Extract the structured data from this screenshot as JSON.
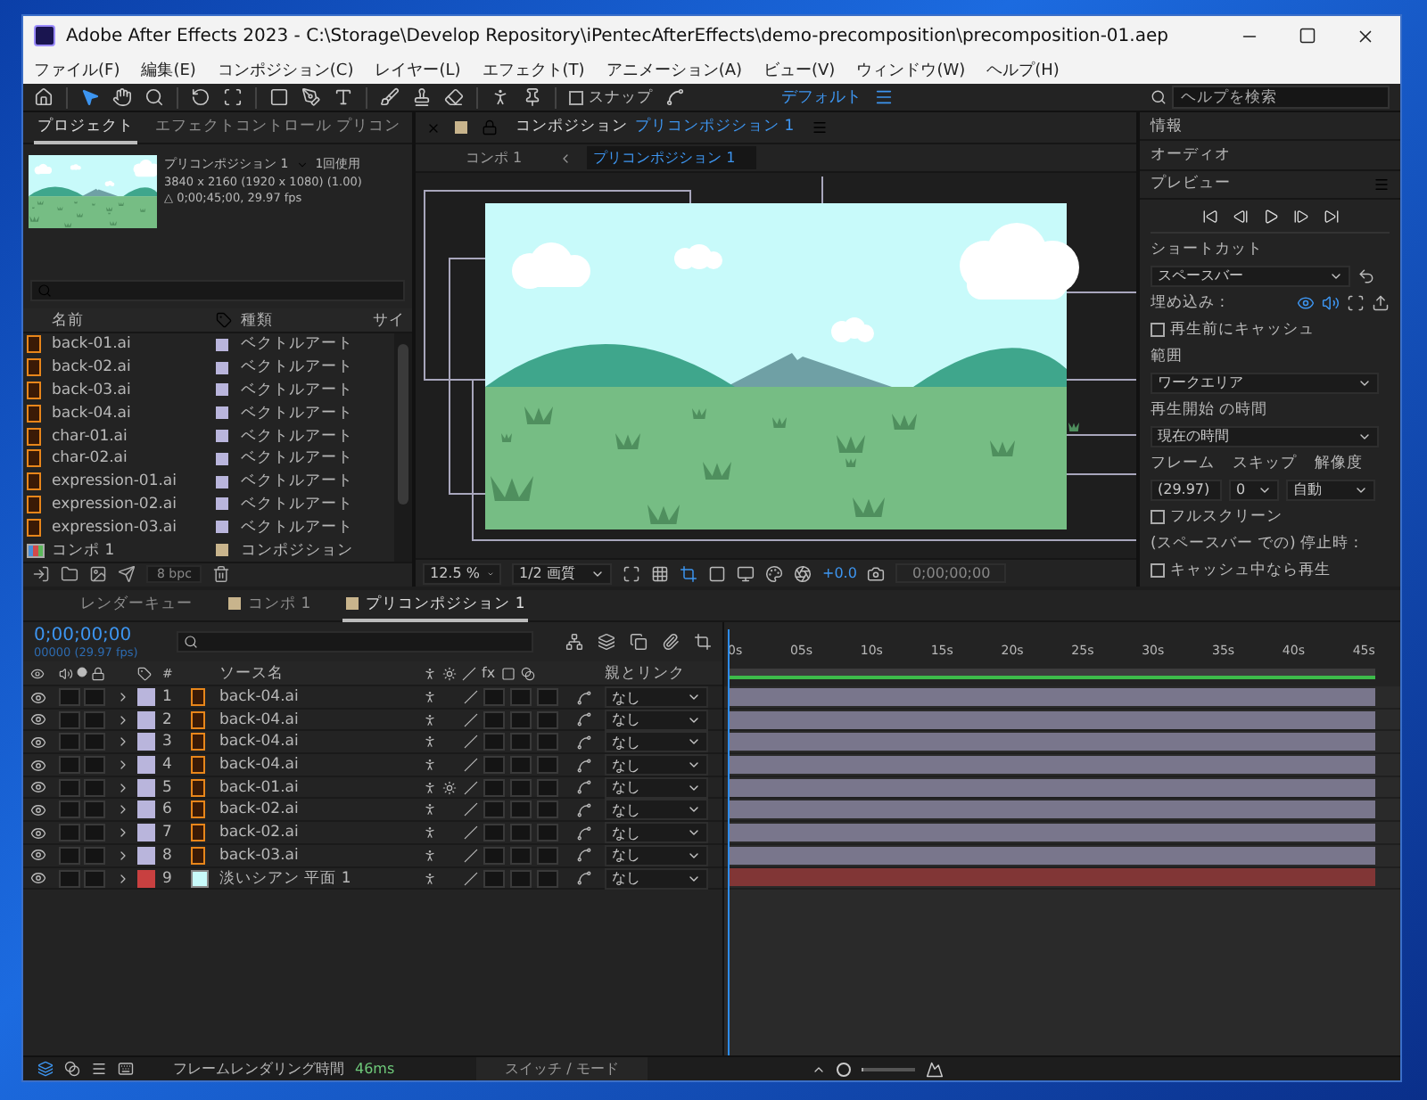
{
  "window": {
    "title": "Adobe After Effects 2023 - C:\\Storage\\Develop Repository\\iPentecAfterEffects\\demo-precomposition\\precomposition-01.aep"
  },
  "menu": [
    "ファイル(F)",
    "編集(E)",
    "コンポジション(C)",
    "レイヤー(L)",
    "エフェクト(T)",
    "アニメーション(A)",
    "ビュー(V)",
    "ウィンドウ(W)",
    "ヘルプ(H)"
  ],
  "toolbar": {
    "snap": {
      "label": "スナップ",
      "checked": false
    },
    "workspace": "デフォルト",
    "help_search": {
      "placeholder": "ヘルプを検索"
    }
  },
  "project": {
    "tabs": [
      {
        "label": "プロジェクト",
        "selected": true
      },
      {
        "label": "エフェクトコントロール プリコン",
        "selected": false
      }
    ],
    "preview": {
      "name": "プリコンポジション 1",
      "usage": "1回使用",
      "size": "3840 x 2160  (1920 x 1080) (1.00)",
      "duration": "△ 0;00;45;00, 29.97 fps"
    },
    "columns": [
      "名前",
      "種類",
      "サイ"
    ],
    "items": [
      {
        "name": "back-01.ai",
        "kind": "ai",
        "color": "#b9b5dc",
        "type": "ベクトルアート"
      },
      {
        "name": "back-02.ai",
        "kind": "ai",
        "color": "#b9b5dc",
        "type": "ベクトルアート"
      },
      {
        "name": "back-03.ai",
        "kind": "ai",
        "color": "#b9b5dc",
        "type": "ベクトルアート"
      },
      {
        "name": "back-04.ai",
        "kind": "ai",
        "color": "#b9b5dc",
        "type": "ベクトルアート"
      },
      {
        "name": "char-01.ai",
        "kind": "ai",
        "color": "#b9b5dc",
        "type": "ベクトルアート"
      },
      {
        "name": "char-02.ai",
        "kind": "ai",
        "color": "#b9b5dc",
        "type": "ベクトルアート"
      },
      {
        "name": "expression-01.ai",
        "kind": "ai",
        "color": "#b9b5dc",
        "type": "ベクトルアート"
      },
      {
        "name": "expression-02.ai",
        "kind": "ai",
        "color": "#b9b5dc",
        "type": "ベクトルアート"
      },
      {
        "name": "expression-03.ai",
        "kind": "ai",
        "color": "#b9b5dc",
        "type": "ベクトルアート"
      },
      {
        "name": "コンポ 1",
        "kind": "comp",
        "color": "#c8b48c",
        "type": "コンポジション"
      }
    ],
    "bpc": "8 bpc"
  },
  "composition": {
    "tab_label": "コンポジション",
    "comp_name": "プリコンポジション 1",
    "breadcrumb": [
      {
        "label": "コンポ 1",
        "selected": false
      },
      {
        "label": "プリコンポジション 1",
        "selected": true
      }
    ],
    "zoom": "12.5 %",
    "quality": "1/2 画質",
    "exposure": "+0.0",
    "timecode": "0;00;00;00"
  },
  "right_panel": {
    "sections": [
      "情報",
      "オーディオ"
    ],
    "preview": {
      "title": "プレビュー",
      "shortcut_label": "ショートカット",
      "shortcut": "スペースバー",
      "embed_label": "埋め込み :",
      "cache_before": {
        "label": "再生前にキャッシュ",
        "checked": false
      },
      "range_label": "範囲",
      "range": "ワークエリア",
      "start_label": "再生開始 の時間",
      "start": "現在の時間",
      "frame_label": "フレーム",
      "skip_label": "スキップ",
      "resolution_label": "解像度",
      "frame": "(29.97)",
      "skip": "0",
      "resolution": "自動",
      "fullscreen": {
        "label": "フルスクリーン",
        "checked": false
      },
      "stop_label": "(スペースバー での) 停止時 :",
      "play_if_caching": {
        "label": "キャッシュ中なら再生",
        "checked": false
      }
    }
  },
  "timeline": {
    "tabs": [
      {
        "label": "レンダーキュー",
        "selected": false,
        "swatch": false
      },
      {
        "label": "コンポ 1",
        "selected": false,
        "swatch": true
      },
      {
        "label": "プリコンポジション 1",
        "selected": true,
        "swatch": true
      }
    ],
    "time": "0;00;00;00",
    "frames": "00000 (29.97 fps)",
    "columns": {
      "number": "#",
      "source": "ソース名",
      "fx": "fx",
      "parent": "親とリンク"
    },
    "ruler": [
      "0s",
      "05s",
      "10s",
      "15s",
      "20s",
      "25s",
      "30s",
      "35s",
      "40s",
      "45s"
    ],
    "layers": [
      {
        "number": "1",
        "name": "back-04.ai",
        "kind": "ai",
        "color": "#b9b5dc",
        "visible": true,
        "solo": false,
        "locked": false,
        "collapse": false,
        "parent": "なし"
      },
      {
        "number": "2",
        "name": "back-04.ai",
        "kind": "ai",
        "color": "#b9b5dc",
        "visible": true,
        "solo": false,
        "locked": false,
        "collapse": false,
        "parent": "なし"
      },
      {
        "number": "3",
        "name": "back-04.ai",
        "kind": "ai",
        "color": "#b9b5dc",
        "visible": true,
        "solo": false,
        "locked": false,
        "collapse": false,
        "parent": "なし"
      },
      {
        "number": "4",
        "name": "back-04.ai",
        "kind": "ai",
        "color": "#b9b5dc",
        "visible": true,
        "solo": false,
        "locked": false,
        "collapse": false,
        "parent": "なし"
      },
      {
        "number": "5",
        "name": "back-01.ai",
        "kind": "ai",
        "color": "#b9b5dc",
        "visible": true,
        "solo": false,
        "locked": false,
        "collapse": true,
        "parent": "なし"
      },
      {
        "number": "6",
        "name": "back-02.ai",
        "kind": "ai",
        "color": "#b9b5dc",
        "visible": true,
        "solo": false,
        "locked": false,
        "collapse": false,
        "parent": "なし"
      },
      {
        "number": "7",
        "name": "back-02.ai",
        "kind": "ai",
        "color": "#b9b5dc",
        "visible": true,
        "solo": false,
        "locked": false,
        "collapse": false,
        "parent": "なし"
      },
      {
        "number": "8",
        "name": "back-03.ai",
        "kind": "ai",
        "color": "#b9b5dc",
        "visible": true,
        "solo": false,
        "locked": false,
        "collapse": false,
        "parent": "なし"
      },
      {
        "number": "9",
        "name": "淡いシアン 平面 1",
        "kind": "solid",
        "color": "#c84040",
        "visible": true,
        "solo": false,
        "locked": false,
        "collapse": false,
        "parent": "なし"
      }
    ]
  },
  "status": {
    "label": "フレームレンダリング時間",
    "value": "46ms",
    "toggle": "スイッチ / モード",
    "zoom": {
      "level": 0.05
    }
  }
}
